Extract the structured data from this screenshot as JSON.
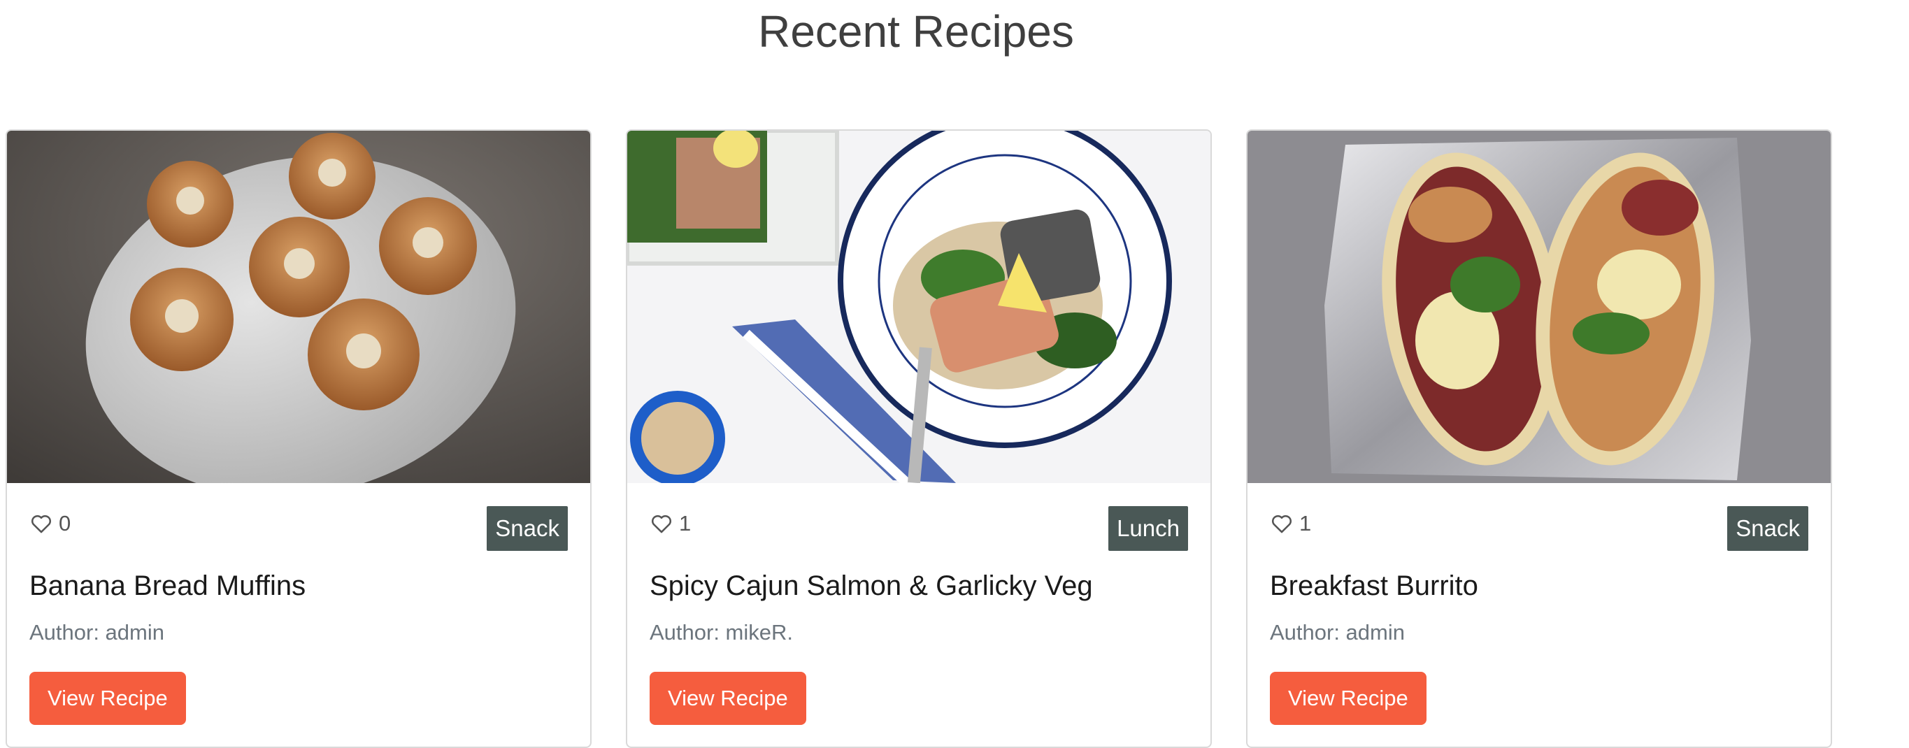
{
  "page": {
    "title": "Recent Recipes"
  },
  "recipes": [
    {
      "likes": "0",
      "category": "Snack",
      "title": "Banana Bread Muffins",
      "author": "Author: admin",
      "button_label": "View Recipe",
      "image": "banana-bread-muffins-photo"
    },
    {
      "likes": "1",
      "category": "Lunch",
      "title": "Spicy Cajun Salmon & Garlicky Veg",
      "author": "Author: mikeR.",
      "button_label": "View Recipe",
      "image": "cajun-salmon-photo"
    },
    {
      "likes": "1",
      "category": "Snack",
      "title": "Breakfast Burrito",
      "author": "Author: admin",
      "button_label": "View Recipe",
      "image": "breakfast-burrito-photo"
    }
  ],
  "colors": {
    "button": "#f55d3e",
    "badge": "#4a5856",
    "title": "#3f3f3f"
  },
  "icons": {
    "like": "heart-outline-icon"
  }
}
